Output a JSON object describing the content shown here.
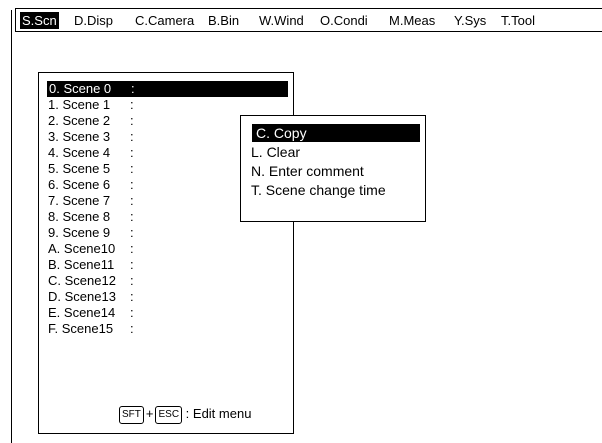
{
  "menubar": {
    "items": [
      {
        "label": "S.Scn",
        "active": true
      },
      {
        "label": "D.Disp"
      },
      {
        "label": "C.Camera"
      },
      {
        "label": "B.Bin"
      },
      {
        "label": "W.Wind"
      },
      {
        "label": "O.Condi"
      },
      {
        "label": "M.Meas"
      },
      {
        "label": "Y.Sys"
      },
      {
        "label": "T.Tool"
      }
    ]
  },
  "scenes": {
    "items": [
      {
        "code": "0. Scene 0",
        "sep": ":",
        "active": true
      },
      {
        "code": "1. Scene 1",
        "sep": ":"
      },
      {
        "code": "2. Scene 2",
        "sep": ":"
      },
      {
        "code": "3. Scene 3",
        "sep": ":"
      },
      {
        "code": "4. Scene 4",
        "sep": ":"
      },
      {
        "code": "5. Scene 5",
        "sep": ":"
      },
      {
        "code": "6. Scene 6",
        "sep": ":"
      },
      {
        "code": "7. Scene 7",
        "sep": ":"
      },
      {
        "code": "8. Scene 8",
        "sep": ":"
      },
      {
        "code": "9. Scene 9",
        "sep": ":"
      },
      {
        "code": "A. Scene10",
        "sep": ":"
      },
      {
        "code": "B. Scene11",
        "sep": ":"
      },
      {
        "code": "C. Scene12",
        "sep": ":"
      },
      {
        "code": "D. Scene13",
        "sep": ":"
      },
      {
        "code": "E. Scene14",
        "sep": ":"
      },
      {
        "code": "F. Scene15",
        "sep": ":"
      }
    ],
    "hint": {
      "key1": "SFT",
      "plus": "+",
      "key2": "ESC",
      "text": ": Edit menu"
    }
  },
  "popup": {
    "items": [
      {
        "label": "C. Copy",
        "active": true
      },
      {
        "label": "L. Clear"
      },
      {
        "label": "N. Enter comment"
      },
      {
        "label": "T. Scene change time"
      }
    ]
  }
}
